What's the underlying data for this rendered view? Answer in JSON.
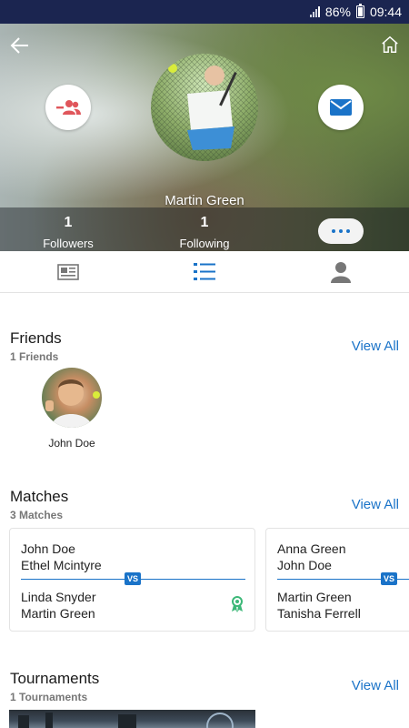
{
  "status": {
    "battery": "86%",
    "time": "09:44"
  },
  "profile": {
    "name": "Martin Green",
    "followers_count": "1",
    "followers_label": "Followers",
    "following_count": "1",
    "following_label": "Following"
  },
  "icons": {
    "back": "back-arrow-icon",
    "home": "home-icon",
    "unfriend": "remove-friend-icon",
    "message": "mail-icon",
    "more": "more-dots-icon",
    "tab_feed": "newspaper-icon",
    "tab_list": "list-icon",
    "tab_profile": "person-icon",
    "winner": "award-ribbon-icon"
  },
  "colors": {
    "accent": "#1a73c8",
    "status_bar": "#1b2550",
    "unfriend": "#e0565b",
    "winner": "#3cb878"
  },
  "friends": {
    "title": "Friends",
    "subtitle": "1 Friends",
    "view_all": "View All",
    "items": [
      {
        "name": "John Doe"
      }
    ]
  },
  "matches": {
    "title": "Matches",
    "subtitle": "3 Matches",
    "view_all": "View All",
    "vs_label": "VS",
    "items": [
      {
        "team_a": [
          "John Doe",
          "Ethel Mcintyre"
        ],
        "team_b": [
          "Linda Snyder",
          "Martin Green"
        ]
      },
      {
        "team_a": [
          "Anna Green",
          "John Doe"
        ],
        "team_b": [
          "Martin Green",
          "Tanisha Ferrell"
        ]
      }
    ]
  },
  "tournaments": {
    "title": "Tournaments",
    "subtitle": "1 Tournaments",
    "view_all": "View All"
  }
}
